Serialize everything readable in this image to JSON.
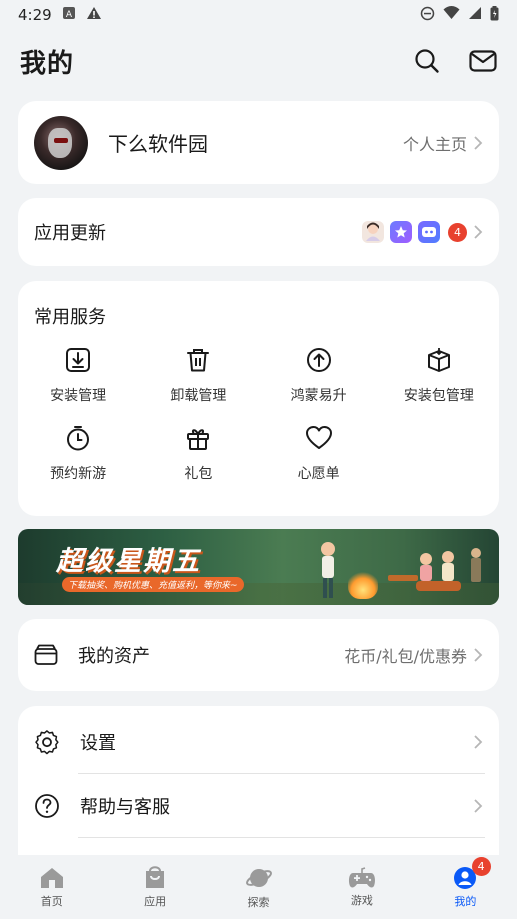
{
  "status_bar": {
    "time": "4:29"
  },
  "header": {
    "title": "我的"
  },
  "profile": {
    "name": "下么软件园",
    "homepage_label": "个人主页"
  },
  "app_update": {
    "label": "应用更新",
    "badge_count": "4"
  },
  "services": {
    "title": "常用服务",
    "items": [
      {
        "label": "安装管理",
        "icon": "install-manage-icon"
      },
      {
        "label": "卸载管理",
        "icon": "uninstall-manage-icon"
      },
      {
        "label": "鸿蒙易升",
        "icon": "harmony-upgrade-icon"
      },
      {
        "label": "安装包管理",
        "icon": "package-manage-icon"
      },
      {
        "label": "预约新游",
        "icon": "reserve-game-icon"
      },
      {
        "label": "礼包",
        "icon": "gift-icon"
      },
      {
        "label": "心愿单",
        "icon": "wishlist-icon"
      }
    ]
  },
  "banner": {
    "title": "超级星期五",
    "subtitle": "下载抽奖、购机优惠、充值返利，等你来~"
  },
  "assets": {
    "label": "我的资产",
    "detail": "花币/礼包/优惠券"
  },
  "settings_list": [
    {
      "label": "设置",
      "icon": "gear-icon"
    },
    {
      "label": "帮助与客服",
      "icon": "help-icon"
    }
  ],
  "bottom_nav": {
    "items": [
      {
        "label": "首页",
        "icon": "home-icon"
      },
      {
        "label": "应用",
        "icon": "apps-icon"
      },
      {
        "label": "探索",
        "icon": "planet-icon"
      },
      {
        "label": "游戏",
        "icon": "gamepad-icon"
      },
      {
        "label": "我的",
        "icon": "profile-icon"
      }
    ],
    "profile_badge": "4",
    "active": "我的"
  },
  "colors": {
    "accent": "#0a59f7",
    "badge": "#e8412e",
    "background": "#f1f3f5"
  }
}
